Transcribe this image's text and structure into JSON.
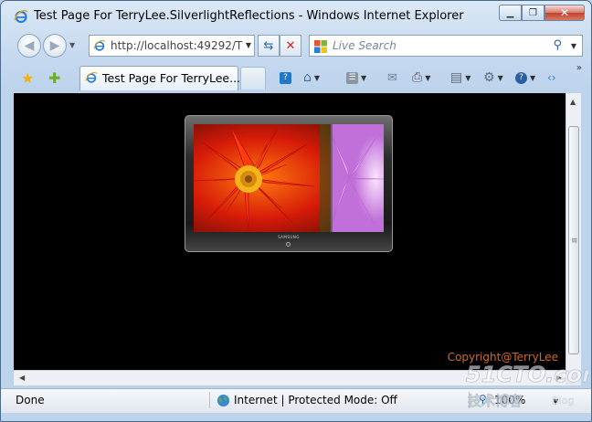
{
  "window": {
    "title": "Test Page For TerryLee.SilverlightReflections - Windows Internet Explorer"
  },
  "nav": {
    "address_url": "http://localhost:49292/T",
    "search_placeholder": "Live Search"
  },
  "tabs": [
    {
      "label": "Test Page For TerryLee...."
    }
  ],
  "content": {
    "copyright": "Copyright@TerryLee",
    "tv_brand": "SAMSUNG"
  },
  "status": {
    "left_text": "Done",
    "zone_text": "Internet | Protected Mode: Off",
    "zoom": "100%"
  },
  "watermark": {
    "site": "51CTO.com",
    "tagline": "技术博客",
    "blog": "Blog"
  },
  "icons": {
    "app": "ie-icon",
    "back": "back-arrow-icon",
    "forward": "forward-arrow-icon",
    "refresh": "refresh-icon",
    "stop": "stop-icon",
    "search": "search-icon",
    "favorites": "star-icon",
    "add_favorites": "add-favorite-icon",
    "home": "home-icon",
    "feeds": "rss-icon",
    "mail": "mail-icon",
    "print": "print-icon",
    "page": "page-icon",
    "tools": "gear-icon",
    "help": "help-icon"
  },
  "colors": {
    "content_bg": "#000000",
    "copyright": "#d06b1e",
    "accent": "#2a5ea5"
  }
}
